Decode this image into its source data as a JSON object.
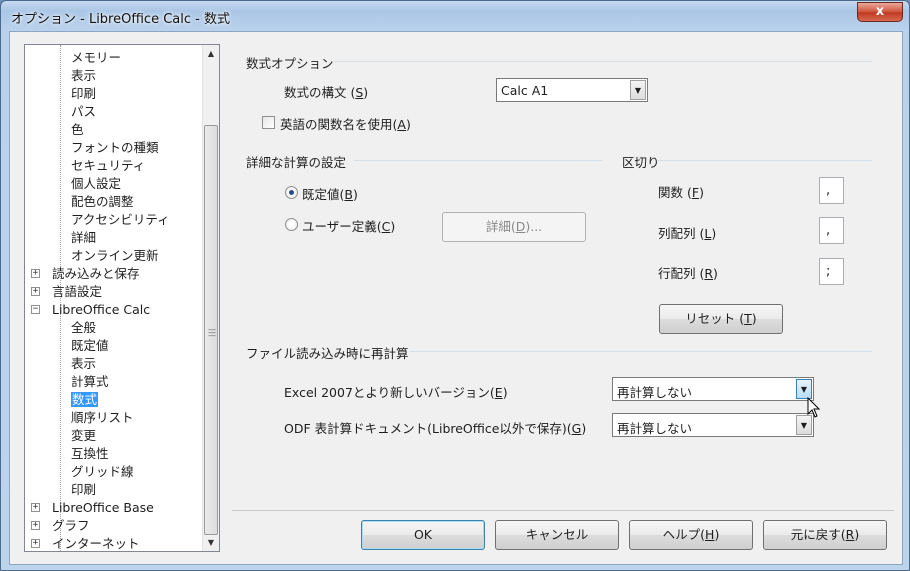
{
  "window": {
    "title": "オプション - LibreOffice Calc - 数式",
    "close_glyph": "x"
  },
  "tree": {
    "items": [
      {
        "label": "メモリー",
        "level": 2
      },
      {
        "label": "表示",
        "level": 2
      },
      {
        "label": "印刷",
        "level": 2
      },
      {
        "label": "パス",
        "level": 2
      },
      {
        "label": "色",
        "level": 2
      },
      {
        "label": "フォントの種類",
        "level": 2
      },
      {
        "label": "セキュリティ",
        "level": 2
      },
      {
        "label": "個人設定",
        "level": 2
      },
      {
        "label": "配色の調整",
        "level": 2
      },
      {
        "label": "アクセシビリティ",
        "level": 2
      },
      {
        "label": "詳細",
        "level": 2
      },
      {
        "label": "オンライン更新",
        "level": 2
      },
      {
        "label": "読み込みと保存",
        "level": 1,
        "expander": "+"
      },
      {
        "label": "言語設定",
        "level": 1,
        "expander": "+"
      },
      {
        "label": "LibreOffice Calc",
        "level": 1,
        "expander": "−"
      },
      {
        "label": "全般",
        "level": 2
      },
      {
        "label": "既定値",
        "level": 2
      },
      {
        "label": "表示",
        "level": 2
      },
      {
        "label": "計算式",
        "level": 2
      },
      {
        "label": "数式",
        "level": 2,
        "selected": true
      },
      {
        "label": "順序リスト",
        "level": 2
      },
      {
        "label": "変更",
        "level": 2
      },
      {
        "label": "互換性",
        "level": 2
      },
      {
        "label": "グリッド線",
        "level": 2
      },
      {
        "label": "印刷",
        "level": 2
      },
      {
        "label": "LibreOffice Base",
        "level": 1,
        "expander": "+"
      },
      {
        "label": "グラフ",
        "level": 1,
        "expander": "+"
      },
      {
        "label": "インターネット",
        "level": 1,
        "expander": "+"
      }
    ]
  },
  "formula_options": {
    "title": "数式オプション",
    "syntax_label": "数式の構文 (",
    "syntax_key": "S",
    "syntax_value": "Calc A1",
    "english_names_label": "英語の関数名を使用(",
    "english_names_key": "A"
  },
  "detailed_calc": {
    "title": "詳細な計算の設定",
    "default_label": "既定値(",
    "default_key": "B",
    "custom_label": "ユーザー定義(",
    "custom_key": "C",
    "details_button": "詳細(",
    "details_key": "D",
    "details_suffix": ")..."
  },
  "separators": {
    "title": "区切り",
    "function_label": "関数 (",
    "function_key": "F",
    "function_value": ",",
    "array_col_label": "列配列 (",
    "array_col_key": "L",
    "array_col_value": ",",
    "array_row_label": "行配列 (",
    "array_row_key": "R",
    "array_row_value": ";",
    "reset_button": "リセット (",
    "reset_key": "T"
  },
  "recalc": {
    "title": "ファイル読み込み時に再計算",
    "excel_label": "Excel 2007とより新しいバージョン(",
    "excel_key": "E",
    "excel_value": "再計算しない",
    "odf_label": "ODF 表計算ドキュメント(LibreOffice以外で保存)(",
    "odf_key": "G",
    "odf_value": "再計算しない"
  },
  "buttons": {
    "ok": "OK",
    "cancel": "キャンセル",
    "help": "ヘルプ(",
    "help_key": "H",
    "reset": "元に戻す(",
    "reset_key": "R",
    "close_paren": ")"
  }
}
